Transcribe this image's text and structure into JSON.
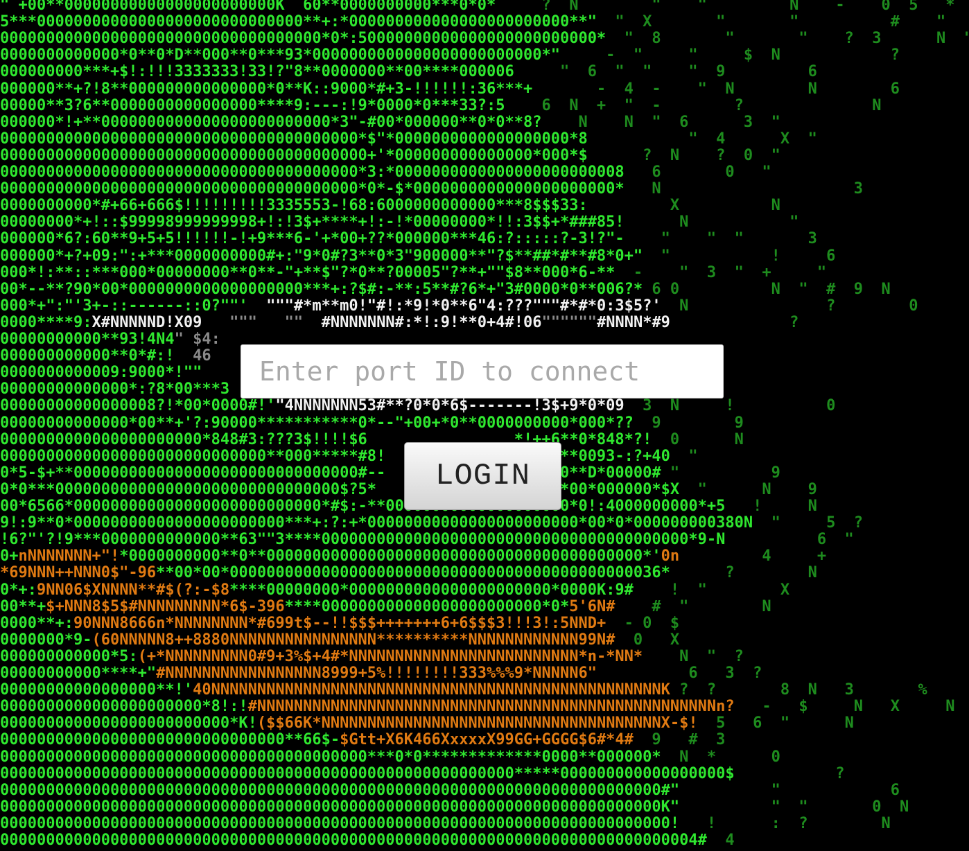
{
  "login": {
    "port_placeholder": "Enter port ID to connect",
    "port_value": "",
    "button_label": "LOGIN"
  },
  "background_ascii": {
    "palette": {
      "green": "#2fe82f",
      "orange": "#e07a12",
      "white": "#f2f2f2",
      "gray": "#8a8a8a"
    },
    "lines": [
      [
        [
          "g",
          "\" +00**00000000000000000000000K  60**0000000000***0*0*"
        ],
        [
          "d",
          "     ?  N        \"    \"         N    -    0  5   *"
        ]
      ],
      [
        [
          "g",
          "5***00000000000000000000000000000**+:*000000000000000000000000**\""
        ],
        [
          "d",
          "  \"  X       \"       \"          #    \"   0  N"
        ]
      ],
      [
        [
          "g",
          "00000000000000000000000000000000000*0*:50000000000000000000000000*"
        ],
        [
          "d",
          "  \"  8       \"       \"    ?  3      N  \""
        ]
      ],
      [
        [
          "g",
          "0000000000000*0**0*D**000**0***93*0000000000000000000000000*\""
        ],
        [
          "d",
          "     -  \"     \"     $  N            ?"
        ]
      ],
      [
        [
          "g",
          "000000000***+$!:!!!3333333!33!?\"8**0000000**00****000006"
        ],
        [
          "d",
          "     \"  6  \"  \"    \"  9         6"
        ]
      ],
      [
        [
          "g",
          "000000**+?!8**000000000000000*0**K::9000*#+3-!!!!!!:36***+"
        ],
        [
          "d",
          "       -  4  -    \"  N        N        6"
        ]
      ],
      [
        [
          "g",
          "00000**3?6**0000000000000000****9:---:!9*0000*0***33?:5"
        ],
        [
          "d",
          "    6  N  +  \"  -        ?              N"
        ]
      ],
      [
        [
          "g",
          "000000*!+**0000000000000000000000000*3\"-#00*000000**0*0**8?"
        ],
        [
          "d",
          "    N    N  \"  6      3  \""
        ]
      ],
      [
        [
          "g",
          "000000000000000000000000000000000000000*$\"*0000000000000000000*8"
        ],
        [
          "d",
          "           \"  4      X  \""
        ]
      ],
      [
        [
          "g",
          "0000000000000000000000000000000000000000+'*000000000000000*000*$"
        ],
        [
          "d",
          "      ?  N    ?  0  \""
        ]
      ],
      [
        [
          "g",
          "000000000000000000000000000000000000000*3:*0000000000000000000000008"
        ],
        [
          "d",
          "   6       0   \""
        ]
      ],
      [
        [
          "g",
          "000000000000000000000000000000000000000*0*-$*0000000000000000000000*"
        ],
        [
          "d",
          "   N                     3"
        ]
      ],
      [
        [
          "g",
          "0000000000*#+66+666$!!!!!!!!!3335553-!68:6000000000000***8$$$33:"
        ],
        [
          "d",
          "         X          N"
        ]
      ],
      [
        [
          "g",
          "00000000*+!::$99998999999998+!:!3$+****+!:-!*00000000*!!:3$$+*###85!"
        ],
        [
          "d",
          "      N           \""
        ]
      ],
      [
        [
          "g",
          "000000*6?:60**9+5+5!!!!!!-!+9***6-'+*00+??*000000***46:?:::::?-3!?\"-"
        ],
        [
          "d",
          "    \"    \"  \"       3"
        ]
      ],
      [
        [
          "g",
          "000000*+?+09:\":+***0000000000#+:\"9*0#?3**0*3\"900000**\"?$**##*#**#8*0+\""
        ],
        [
          "d",
          "  \"           !     6"
        ]
      ],
      [
        [
          "g",
          "000*!:**::***000*00000000**0**-\"+**$\"?*0**?00005\"?**+\"\"$8**000*6-**"
        ],
        [
          "d",
          "  -    \"  3  \"  +     \""
        ]
      ],
      [
        [
          "g",
          "00*--**?90*00*0000000000000000000***+:?$#:-**:5**#?6*+\"3#0000*0**006?*"
        ],
        [
          "d",
          " 6 0          N  \"  #  9  N"
        ]
      ],
      [
        [
          "g",
          "000*+\":\"'3+-::------::0?\"\"'"
        ],
        [
          "w",
          "  \"\"\"#*m**m0!\"#!:*9!*0**6\"4:???\"\"\"#*#*0:3$5?'"
        ],
        [
          "d",
          "  N               ?        0"
        ]
      ],
      [
        [
          "g",
          "0000****9:"
        ],
        [
          "w",
          "X#NNNNND!X09"
        ],
        [
          "x",
          "   \"\"\"   \"\"  "
        ],
        [
          "w",
          "#NNNNNNN#:*!:9!**0+4#!06"
        ],
        [
          "x",
          "\"\"\"\"\"\""
        ],
        [
          "w",
          "#NNNN*#9"
        ],
        [
          "d",
          "             ?"
        ]
      ],
      [
        [
          "g",
          "00000000000**93!4N4"
        ],
        [
          "x",
          "\" $4:"
        ],
        [
          "d",
          "                                                                                                 $    \"     \""
        ]
      ],
      [
        [
          "g",
          "000000000000**0*#:!"
        ],
        [
          "x",
          "  46"
        ],
        [
          "d",
          "                                                                                           \" 3  N  0 "
        ]
      ],
      [
        [
          "g",
          "0000000000009:9000*!\"\""
        ],
        [
          "d",
          "                                                                                           \"  N  \"  *  N  \""
        ]
      ],
      [
        [
          "g",
          "00000000000000*:?8*00***3"
        ],
        [
          "d",
          "                                                                                               ?  N         -"
        ]
      ],
      [
        [
          "g",
          "00000000000000008?!*00*0000#!'"
        ],
        [
          "w",
          "\"4NNNNNNN53#**?0*0*6$-------!3$+9*0*09"
        ],
        [
          "d",
          "  3  N     !          0"
        ]
      ],
      [
        [
          "g",
          "00000000000000*00**+'?:90000***********0*--\"+00+*0**0000000000*000*??"
        ],
        [
          "d",
          "  9        9"
        ]
      ],
      [
        [
          "g",
          "0000000000000000000000*848#3:???3$!!!!$6                *!++6**0*848*?!"
        ],
        [
          "d",
          "  0      N"
        ]
      ],
      [
        [
          "g",
          "00000000000000000000000000000**000*****#8!                $8***0093-:?+40"
        ],
        [
          "d",
          "  \""
        ]
      ],
      [
        [
          "g",
          "0*5-$+**0000000000000000000000000000000#--              !?+**0**D*00000#"
        ],
        [
          "d",
          " \"          9"
        ]
      ],
      [
        [
          "g",
          "0*0***0000000000000000000000000000000$?5*               *K?-6*00*000000*$X"
        ],
        [
          "d",
          "  \"      N    9"
        ]
      ],
      [
        [
          "g",
          "00*6566*000000000000000000000000000*#$:-**00000000000000000000*0!:4000000000*+5"
        ],
        [
          "d",
          "   !     N"
        ]
      ],
      [
        [
          "g",
          "9!:9**0*00000000000000000000000***+:?:+*00000000000000000000000*00*0*000000000380N"
        ],
        [
          "d",
          "  \"     5  ?"
        ]
      ],
      [
        [
          "g",
          "!6?\"'?!9***0000000000000**63\"\"3****0000000000000000000000000000000000000000*9-N"
        ],
        [
          "d",
          "          6  \""
        ]
      ],
      [
        [
          "g",
          "0+"
        ],
        [
          "o",
          "nNNNNNNN+\"!"
        ],
        [
          "g",
          "*0000000000**0**00000000000000000000000000000000000000000*'"
        ],
        [
          "o",
          "0n"
        ],
        [
          "d",
          "         4     +"
        ]
      ],
      [
        [
          "o",
          "*69NNN++NNN0$\"-96"
        ],
        [
          "g",
          "**00*00*00000000000000000000000000000000000000000000036*"
        ],
        [
          "d",
          "      ?        N"
        ]
      ],
      [
        [
          "g",
          "0*+:"
        ],
        [
          "o",
          "9NN06$XNNNN**#$(?:-$8"
        ],
        [
          "g",
          "****00000000*0000000000000000000000*0000K:9#"
        ],
        [
          "d",
          "    !  \"        X"
        ]
      ],
      [
        [
          "g",
          "00**+"
        ],
        [
          "o",
          "$+NNN8$5$#NNNNNNNNN*6$-396"
        ],
        [
          "g",
          "****000000000000000000000000*0*"
        ],
        [
          "o",
          "5'6N#"
        ],
        [
          "d",
          "    #  \"        N"
        ]
      ],
      [
        [
          "g",
          "0000**+:"
        ],
        [
          "o",
          "90NNN8666n*NNNNNNNN*#699t$--!!$$$+++++++6+6$$$3!!!3!:5NND+"
        ],
        [
          "d",
          "  - 0  $"
        ]
      ],
      [
        [
          "g",
          "0000000*9-"
        ],
        [
          "o",
          "(60NNNNN8++8880NNNNNNNNNNNNNNNN**********NNNNNNNNNNNN99N#"
        ],
        [
          "d",
          "  0   X"
        ]
      ],
      [
        [
          "g",
          "000000000000*5:"
        ],
        [
          "o",
          "(+*NNNNNNNNN0#9+3%$+4#*NNNNNNNNNNNNNNNNNNNNNNNNN*n-*NN*"
        ],
        [
          "d",
          "    N  \"  ?"
        ]
      ],
      [
        [
          "g",
          "00000000000****+\""
        ],
        [
          "o",
          "#NNNNNNNNNNNNNNNNN8999+5%!!!!!!!!333%%%9*NNNNN6\""
        ],
        [
          "d",
          "          6   3  ?"
        ]
      ],
      [
        [
          "g",
          "00000000000000000**!'"
        ],
        [
          "o",
          "40NNNNNNNNNNNNNNNNNNNNNNNNNNNNNNNNNNNNNNNNNNNNNNNNNK"
        ],
        [
          "d",
          " ?  ?       8  N   3       %"
        ]
      ],
      [
        [
          "g",
          "0000000000000000000000*8!:!"
        ],
        [
          "o",
          "#NNNNNNNNNNNNNNNNNNNNNNNNNNNNNNNNNNNNNNNNNNNNNNNNNNn?"
        ],
        [
          "d",
          "   -   $     N   X     N"
        ]
      ],
      [
        [
          "g",
          "0000000000000000000000000*K!"
        ],
        [
          "o",
          "($$66K*NNNNNNNNNNNNNNNNNNNNNNNNNNNNNNNNNNNNNX-$!"
        ],
        [
          "d",
          "  5   6  \"      N"
        ]
      ],
      [
        [
          "g",
          "0000000000000000000000000000000**66$-"
        ],
        [
          "o",
          "$Gtt+X6K466XxxxxX99GG+GGGG$6#*4#"
        ],
        [
          "d",
          "  9   #  3"
        ]
      ],
      [
        [
          "g",
          "0000000000000000000000000000000000000000***0*0*************0000**000000*"
        ],
        [
          "d",
          "  N  *      0"
        ]
      ],
      [
        [
          "g",
          "00000000000000000000000000000000000000000000000000000000*****000000000000000000$"
        ],
        [
          "d",
          "           ?"
        ]
      ],
      [
        [
          "g",
          "000000000000000000000000000000000000000000000000000000000000000000000000#\""
        ],
        [
          "d",
          "          \"            6"
        ]
      ],
      [
        [
          "g",
          "000000000000000000000000000000000000000000000000000000000000000000000000K\""
        ],
        [
          "d",
          "          \"  \"       0  N"
        ]
      ],
      [
        [
          "g",
          "0000000000000000000000000000000000000000000000000000000000000000000000000!"
        ],
        [
          "d",
          "   !      :  ?        N"
        ]
      ],
      [
        [
          "g",
          "0000000000000000000000000000000000000000000000000000000000000000000000000004#"
        ],
        [
          "d",
          "  4"
        ]
      ]
    ]
  }
}
